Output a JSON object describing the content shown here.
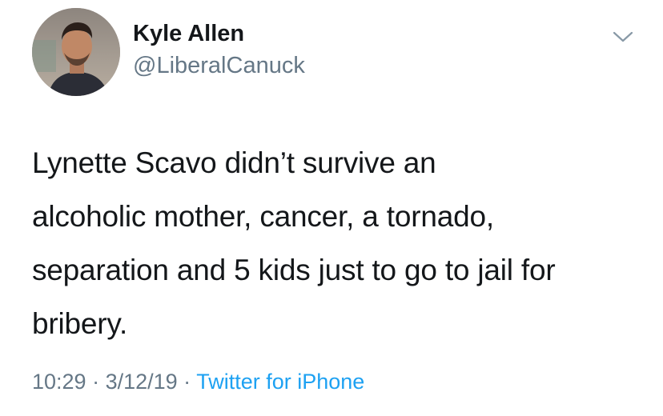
{
  "author": {
    "name": "Kyle Allen",
    "handle": "@LiberalCanuck"
  },
  "tweet": {
    "lines": [
      "Lynette Scavo didn’t survive an",
      "alcoholic mother, cancer, a tornado,",
      "separation and 5 kids just to go to jail for",
      "bribery."
    ]
  },
  "meta": {
    "time": "10:29",
    "separator": " · ",
    "date": "3/12/19",
    "source": "Twitter for iPhone"
  },
  "icons": {
    "menu": "chevron-down-icon",
    "avatar": "avatar"
  },
  "colors": {
    "text": "#14171a",
    "secondary": "#657786",
    "link": "#1da1f2"
  }
}
